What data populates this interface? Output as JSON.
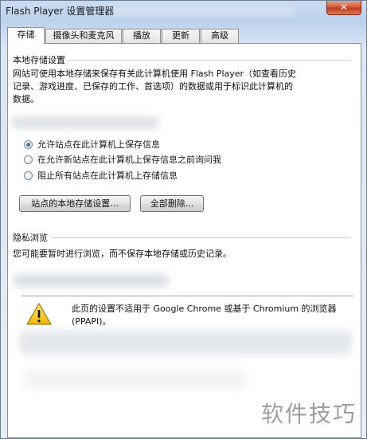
{
  "window": {
    "title": "Flash Player 设置管理器",
    "close_label": "✕"
  },
  "tabs": [
    {
      "label": "存储",
      "active": true
    },
    {
      "label": "摄像头和麦克风",
      "active": false
    },
    {
      "label": "播放",
      "active": false
    },
    {
      "label": "更新",
      "active": false
    },
    {
      "label": "高级",
      "active": false
    }
  ],
  "local_storage": {
    "heading": "本地存储设置",
    "description_line1": "网站可使用本地存储来保存有关此计算机使用 Flash Player（如查看历史",
    "description_line2": "记录、游戏进度、已保存的工作、首选项）的数据或用于标识此计算机的",
    "description_line3": "数据。",
    "options": [
      {
        "label": "允许站点在此计算机上保存信息",
        "checked": true
      },
      {
        "label": "在允许新站点在此计算机上保存信息之前询问我",
        "checked": false
      },
      {
        "label": "阻止所有站点在此计算机上存储信息",
        "checked": false
      }
    ],
    "site_settings_button": "站点的本地存储设置...",
    "delete_all_button": "全部删除..."
  },
  "private_browsing": {
    "heading": "隐私浏览",
    "description": "您可能要暂时进行浏览，而不保存本地存储或历史记录。"
  },
  "warning": {
    "icon": "warning-icon",
    "line1": "此页的设置不适用于 Google Chrome 或基于 Chromium 的浏览器",
    "line2": "(PPAPI)。"
  },
  "watermark": "软件技巧"
}
